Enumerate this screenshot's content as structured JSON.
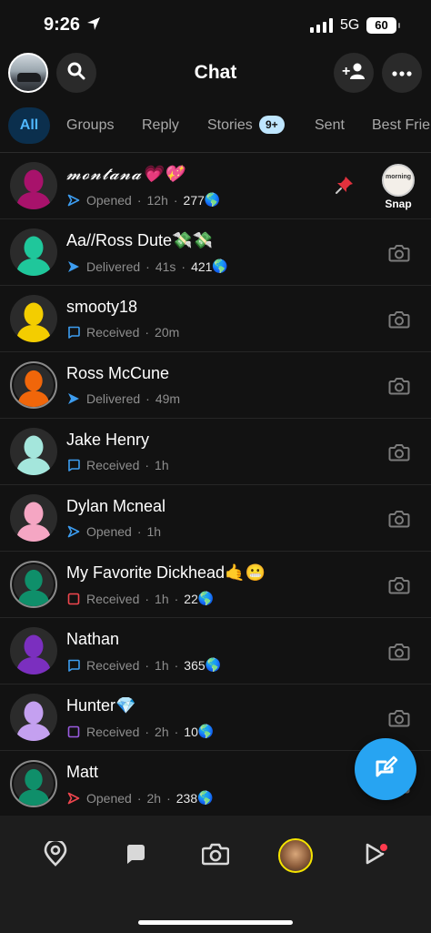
{
  "status_bar": {
    "time": "9:26",
    "network": "5G",
    "battery": "60"
  },
  "header": {
    "title": "Chat"
  },
  "tabs": [
    {
      "label": "All"
    },
    {
      "label": "Groups"
    },
    {
      "label": "Reply"
    },
    {
      "label": "Stories",
      "badge": "9+"
    },
    {
      "label": "Sent"
    },
    {
      "label": "Best Frie"
    }
  ],
  "chats": [
    {
      "name": "𝓶𝓸𝓷𝓽𝓪𝓷𝓪💗💖",
      "status": "Opened",
      "time": "12h",
      "score": "277",
      "score_emoji": "🌎",
      "status_icon": "sent-arrow-outline-icon",
      "status_color": "#3d9df0",
      "avatar_color": "#a8126b",
      "pinned": true,
      "snap_thumb_text": "morning",
      "snap_label": "Snap"
    },
    {
      "name": "Aa//Ross Dute💸💸",
      "status": "Delivered",
      "time": "41s",
      "score": "421",
      "score_emoji": "🌎",
      "status_icon": "sent-arrow-filled-icon",
      "status_color": "#3d9df0",
      "avatar_color": "#1fc79b"
    },
    {
      "name": "smooty18",
      "status": "Received",
      "time": "20m",
      "score": "",
      "score_emoji": "",
      "status_icon": "chat-outline-icon",
      "status_color": "#3d9df0",
      "avatar_color": "#f3cd00"
    },
    {
      "name": "Ross McCune",
      "status": "Delivered",
      "time": "49m",
      "score": "",
      "score_emoji": "",
      "status_icon": "sent-arrow-filled-icon",
      "status_color": "#3d9df0",
      "avatar_color": "#f0660a",
      "ring": true
    },
    {
      "name": "Jake Henry",
      "status": "Received",
      "time": "1h",
      "score": "",
      "score_emoji": "",
      "status_icon": "chat-outline-icon",
      "status_color": "#3d9df0",
      "avatar_color": "#a4e6dc"
    },
    {
      "name": "Dylan Mcneal",
      "status": "Opened",
      "time": "1h",
      "score": "",
      "score_emoji": "",
      "status_icon": "sent-arrow-outline-icon",
      "status_color": "#3d9df0",
      "avatar_color": "#f5a6c3"
    },
    {
      "name": "My Favorite Dickhead🤙😬",
      "status": "Received",
      "time": "1h",
      "score": "22",
      "score_emoji": "🌎",
      "status_icon": "snap-outline-icon",
      "status_color": "#f0464e",
      "avatar_color": "#0f8f6a",
      "ring": true
    },
    {
      "name": "Nathan",
      "status": "Received",
      "time": "1h",
      "score": "365",
      "score_emoji": "🌎",
      "status_icon": "chat-outline-icon",
      "status_color": "#3d9df0",
      "avatar_color": "#7b2fbf"
    },
    {
      "name": "Hunter💎",
      "status": "Received",
      "time": "2h",
      "score": "10",
      "score_emoji": "🌎",
      "status_icon": "video-outline-icon",
      "status_color": "#9a5be0",
      "avatar_color": "#c4a0f0"
    },
    {
      "name": "Matt",
      "status": "Opened",
      "time": "2h",
      "score": "238",
      "score_emoji": "🌎",
      "status_icon": "sent-arrow-outline-icon",
      "status_color": "#f0464e",
      "avatar_color": "#0f8f6a",
      "ring": true
    }
  ],
  "colors": {
    "accent": "#27a4f2",
    "tab_active_bg": "#0b2f4d",
    "tab_active_text": "#4fb7ff",
    "background": "#121212",
    "profile_ring": "#f5e400",
    "notification_dot": "#ff3b4e"
  }
}
